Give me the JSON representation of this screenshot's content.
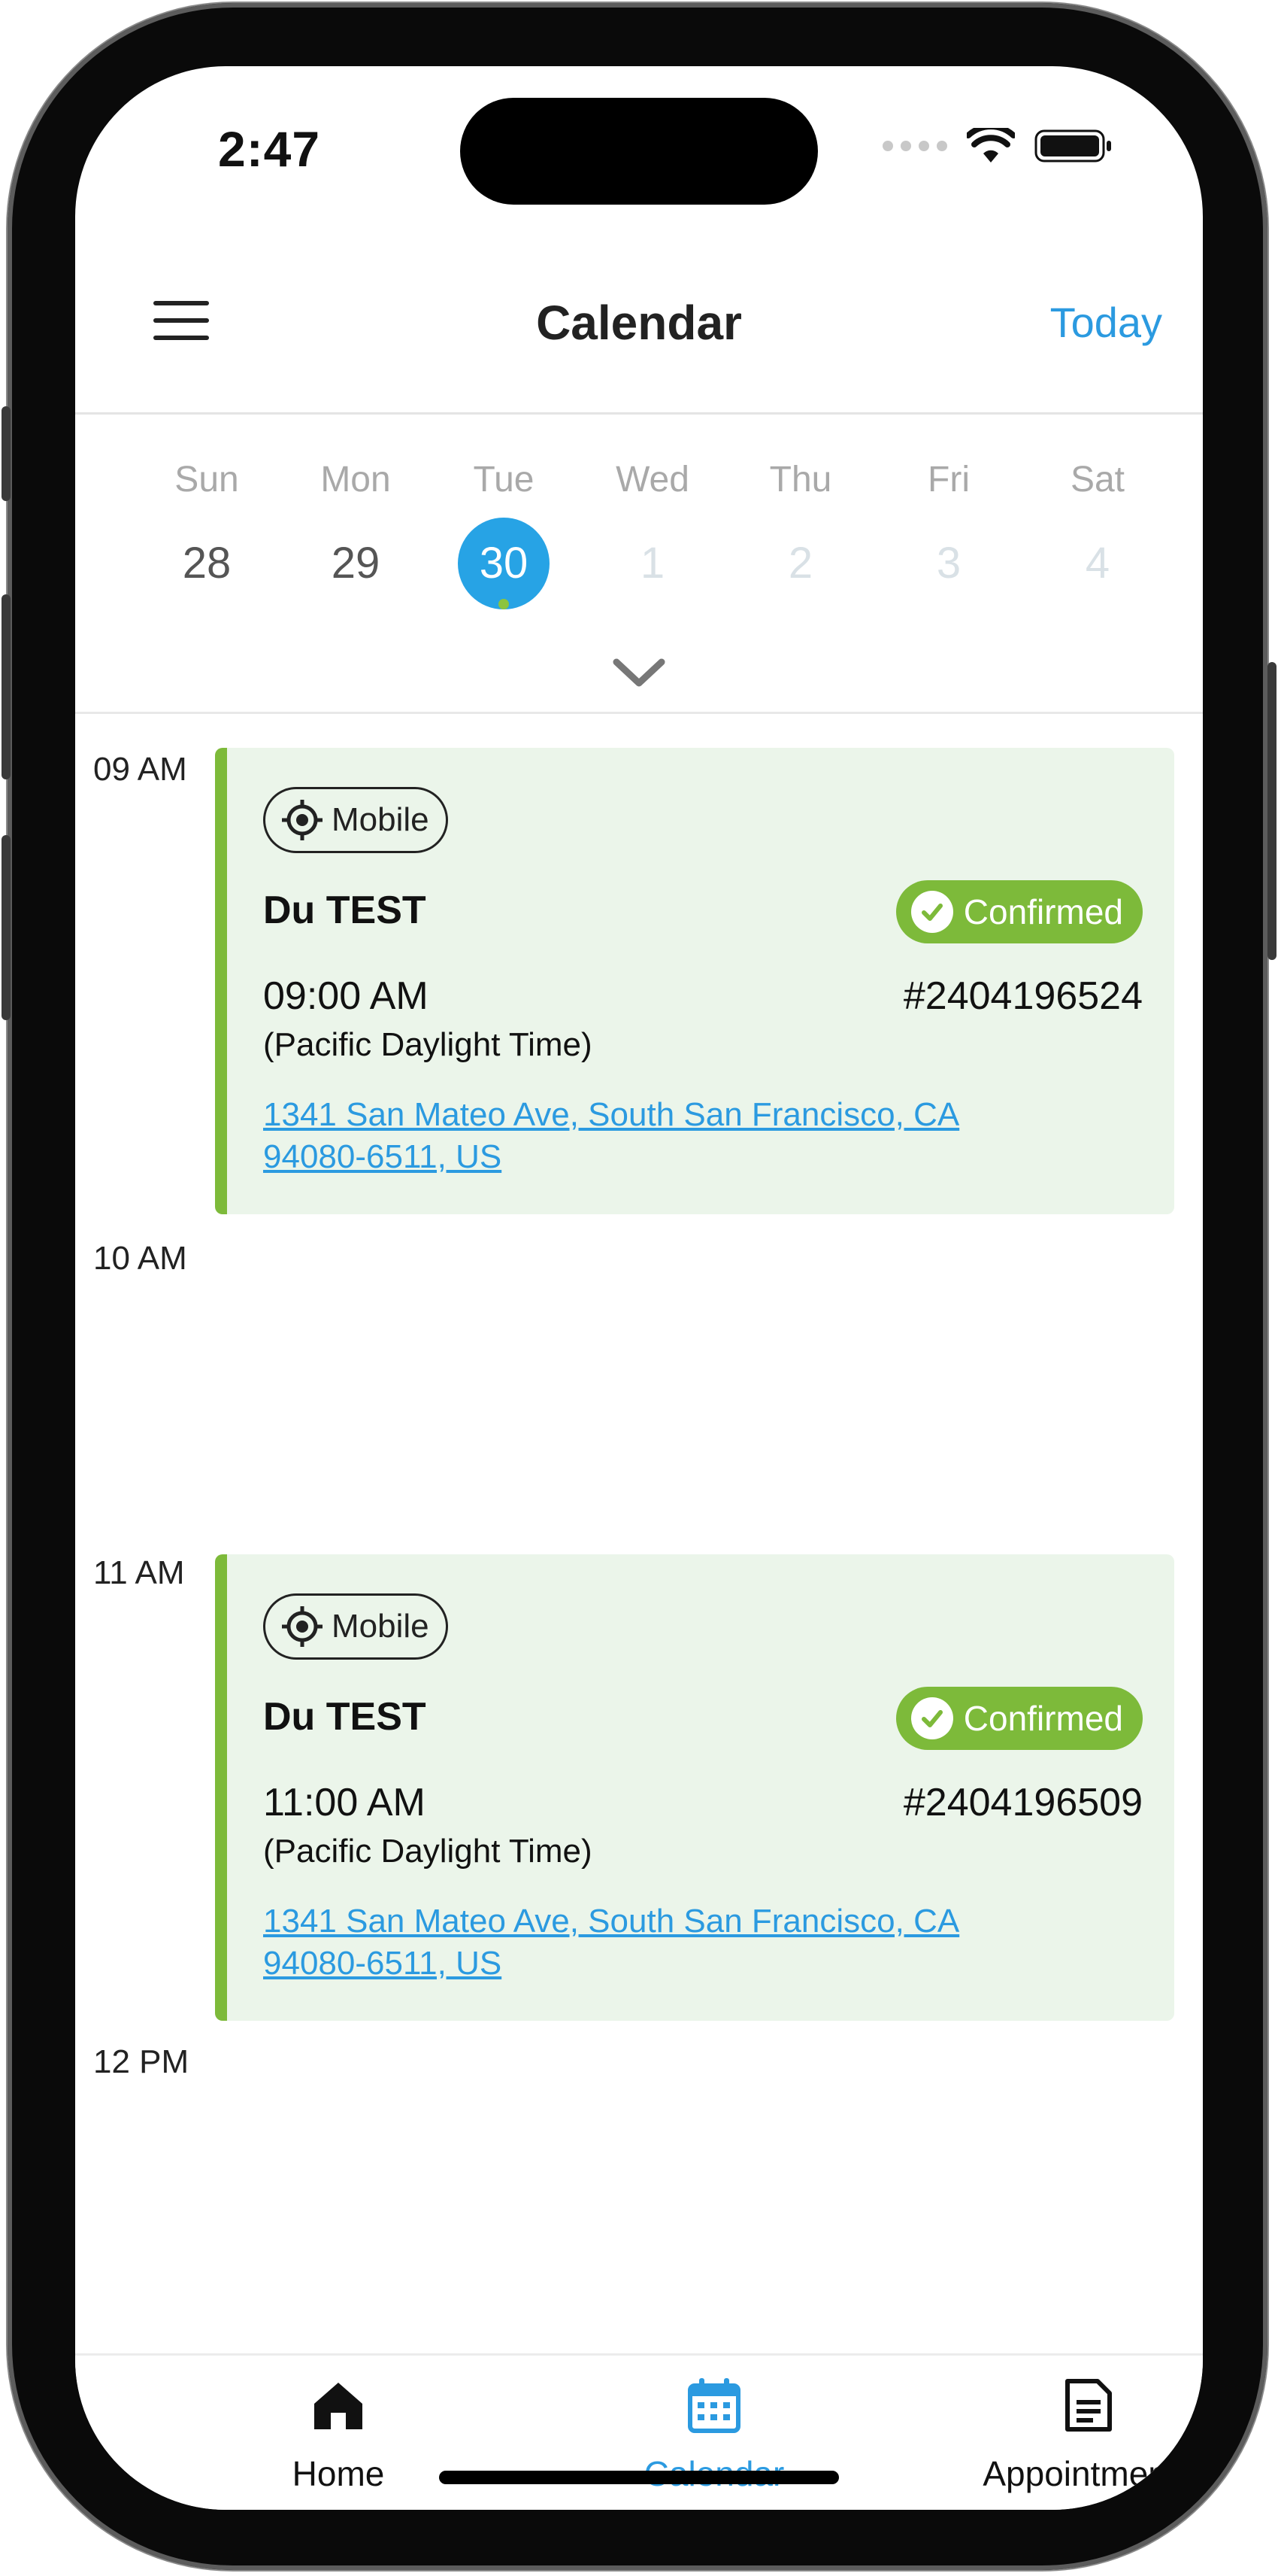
{
  "status": {
    "time": "2:47"
  },
  "header": {
    "title": "Calendar",
    "today_label": "Today"
  },
  "week": {
    "days": [
      {
        "name": "Sun",
        "date": "28",
        "state": "past"
      },
      {
        "name": "Mon",
        "date": "29",
        "state": "past"
      },
      {
        "name": "Tue",
        "date": "30",
        "state": "selected"
      },
      {
        "name": "Wed",
        "date": "1",
        "state": "future"
      },
      {
        "name": "Thu",
        "date": "2",
        "state": "future"
      },
      {
        "name": "Fri",
        "date": "3",
        "state": "future"
      },
      {
        "name": "Sat",
        "date": "4",
        "state": "future"
      }
    ]
  },
  "timeline": {
    "labels": [
      "09 AM",
      "10 AM",
      "11 AM",
      "12 PM"
    ],
    "appointments": [
      {
        "type": "Mobile",
        "customer": "Du TEST",
        "status": "Confirmed",
        "time": "09:00 AM",
        "timezone": "(Pacific Daylight Time)",
        "number": "#2404196524",
        "address_line1": "1341 San Mateo Ave, South San Francisco, CA",
        "address_line2": "94080-6511, US"
      },
      {
        "type": "Mobile",
        "customer": "Du TEST",
        "status": "Confirmed",
        "time": "11:00 AM",
        "timezone": "(Pacific Daylight Time)",
        "number": "#2404196509",
        "address_line1": "1341 San Mateo Ave, South San Francisco, CA",
        "address_line2": "94080-6511, US"
      }
    ]
  },
  "tabbar": {
    "tabs": [
      {
        "label": "Home",
        "icon": "home-icon",
        "active": false
      },
      {
        "label": "Calendar",
        "icon": "calendar-icon",
        "active": true
      },
      {
        "label": "Appointments",
        "icon": "document-icon",
        "active": false
      }
    ]
  },
  "colors": {
    "accent": "#2b9ae0",
    "selected_day": "#27a3e5",
    "confirmed": "#7dba3a",
    "card_bg": "#ebf5ea"
  }
}
